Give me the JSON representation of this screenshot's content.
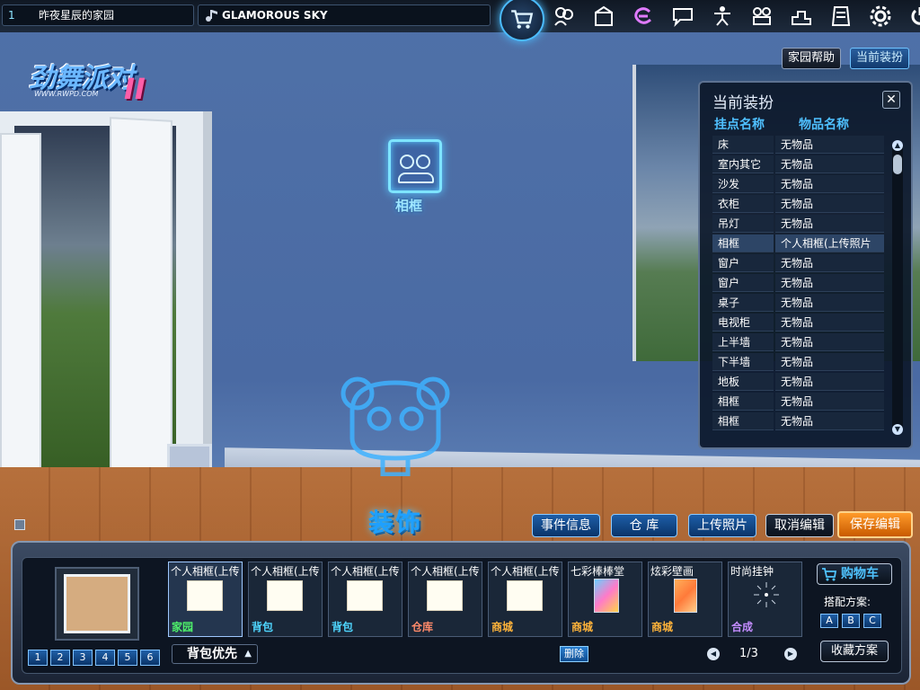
{
  "topbar": {
    "channel_num": "1",
    "room_name": "昨夜星辰的家园",
    "song_title": "GLAMOROUS SKY",
    "icons": [
      "cart-icon",
      "user-pair-icon",
      "gift-box-icon",
      "swirl-e-icon",
      "chat-icon",
      "dancer-icon",
      "couple-icon",
      "podium-icon",
      "note-icon",
      "gear-icon",
      "power-icon"
    ]
  },
  "logo": {
    "text": "劲舞派对",
    "url": "WWW.RWPD.COM",
    "suffix": "II"
  },
  "top_buttons": {
    "help": "家园帮助",
    "current": "当前装扮"
  },
  "scene": {
    "frame_label": "相框",
    "section_title": "装饰"
  },
  "outfit_panel": {
    "title": "当前装扮",
    "col_slot": "挂点名称",
    "col_item": "物品名称",
    "rows": [
      {
        "slot": "床",
        "item": "无物品"
      },
      {
        "slot": "室内其它",
        "item": "无物品"
      },
      {
        "slot": "沙发",
        "item": "无物品"
      },
      {
        "slot": "衣柜",
        "item": "无物品"
      },
      {
        "slot": "吊灯",
        "item": "无物品"
      },
      {
        "slot": "相框",
        "item": "个人相框(上传照片",
        "selected": true
      },
      {
        "slot": "窗户",
        "item": "无物品"
      },
      {
        "slot": "窗户",
        "item": "无物品"
      },
      {
        "slot": "桌子",
        "item": "无物品"
      },
      {
        "slot": "电视柜",
        "item": "无物品"
      },
      {
        "slot": "上半墙",
        "item": "无物品"
      },
      {
        "slot": "下半墙",
        "item": "无物品"
      },
      {
        "slot": "地板",
        "item": "无物品"
      },
      {
        "slot": "相框",
        "item": "无物品"
      },
      {
        "slot": "相框",
        "item": "无物品"
      }
    ]
  },
  "actions": {
    "event_info": "事件信息",
    "warehouse": "仓 库",
    "upload_photo": "上传照片",
    "cancel_edit": "取消编辑",
    "save_edit": "保存编辑"
  },
  "bottom": {
    "room_tabs": [
      "1",
      "2",
      "3",
      "4",
      "5",
      "6"
    ],
    "sort_label": "背包优先",
    "items": [
      {
        "name": "个人相框(上传",
        "source": "家园",
        "src_class": "src-home",
        "thumb": "white"
      },
      {
        "name": "个人相框(上传",
        "source": "背包",
        "src_class": "src-bag",
        "thumb": "white"
      },
      {
        "name": "个人相框(上传",
        "source": "背包",
        "src_class": "src-bag",
        "thumb": "white"
      },
      {
        "name": "个人相框(上传",
        "source": "仓库",
        "src_class": "src-store",
        "thumb": "white"
      },
      {
        "name": "个人相框(上传",
        "source": "商城",
        "src_class": "src-mall",
        "thumb": "white"
      },
      {
        "name": "七彩棒棒堂",
        "source": "商城",
        "src_class": "src-mall",
        "thumb": "poster-blue"
      },
      {
        "name": "炫彩壁画",
        "source": "商城",
        "src_class": "src-mall",
        "thumb": "poster-orange"
      },
      {
        "name": "时尚挂钟",
        "source": "合成",
        "src_class": "src-syn",
        "thumb": "clock"
      }
    ],
    "delete_label": "删除",
    "page": "1/3",
    "cart_label": "购物车",
    "scheme_label": "搭配方案:",
    "schemes": [
      "A",
      "B",
      "C"
    ],
    "favorite_label": "收藏方案"
  },
  "colors": {
    "accent": "#4fc0ff",
    "save": "#ff8c1a",
    "wall": "#4f71a8"
  }
}
